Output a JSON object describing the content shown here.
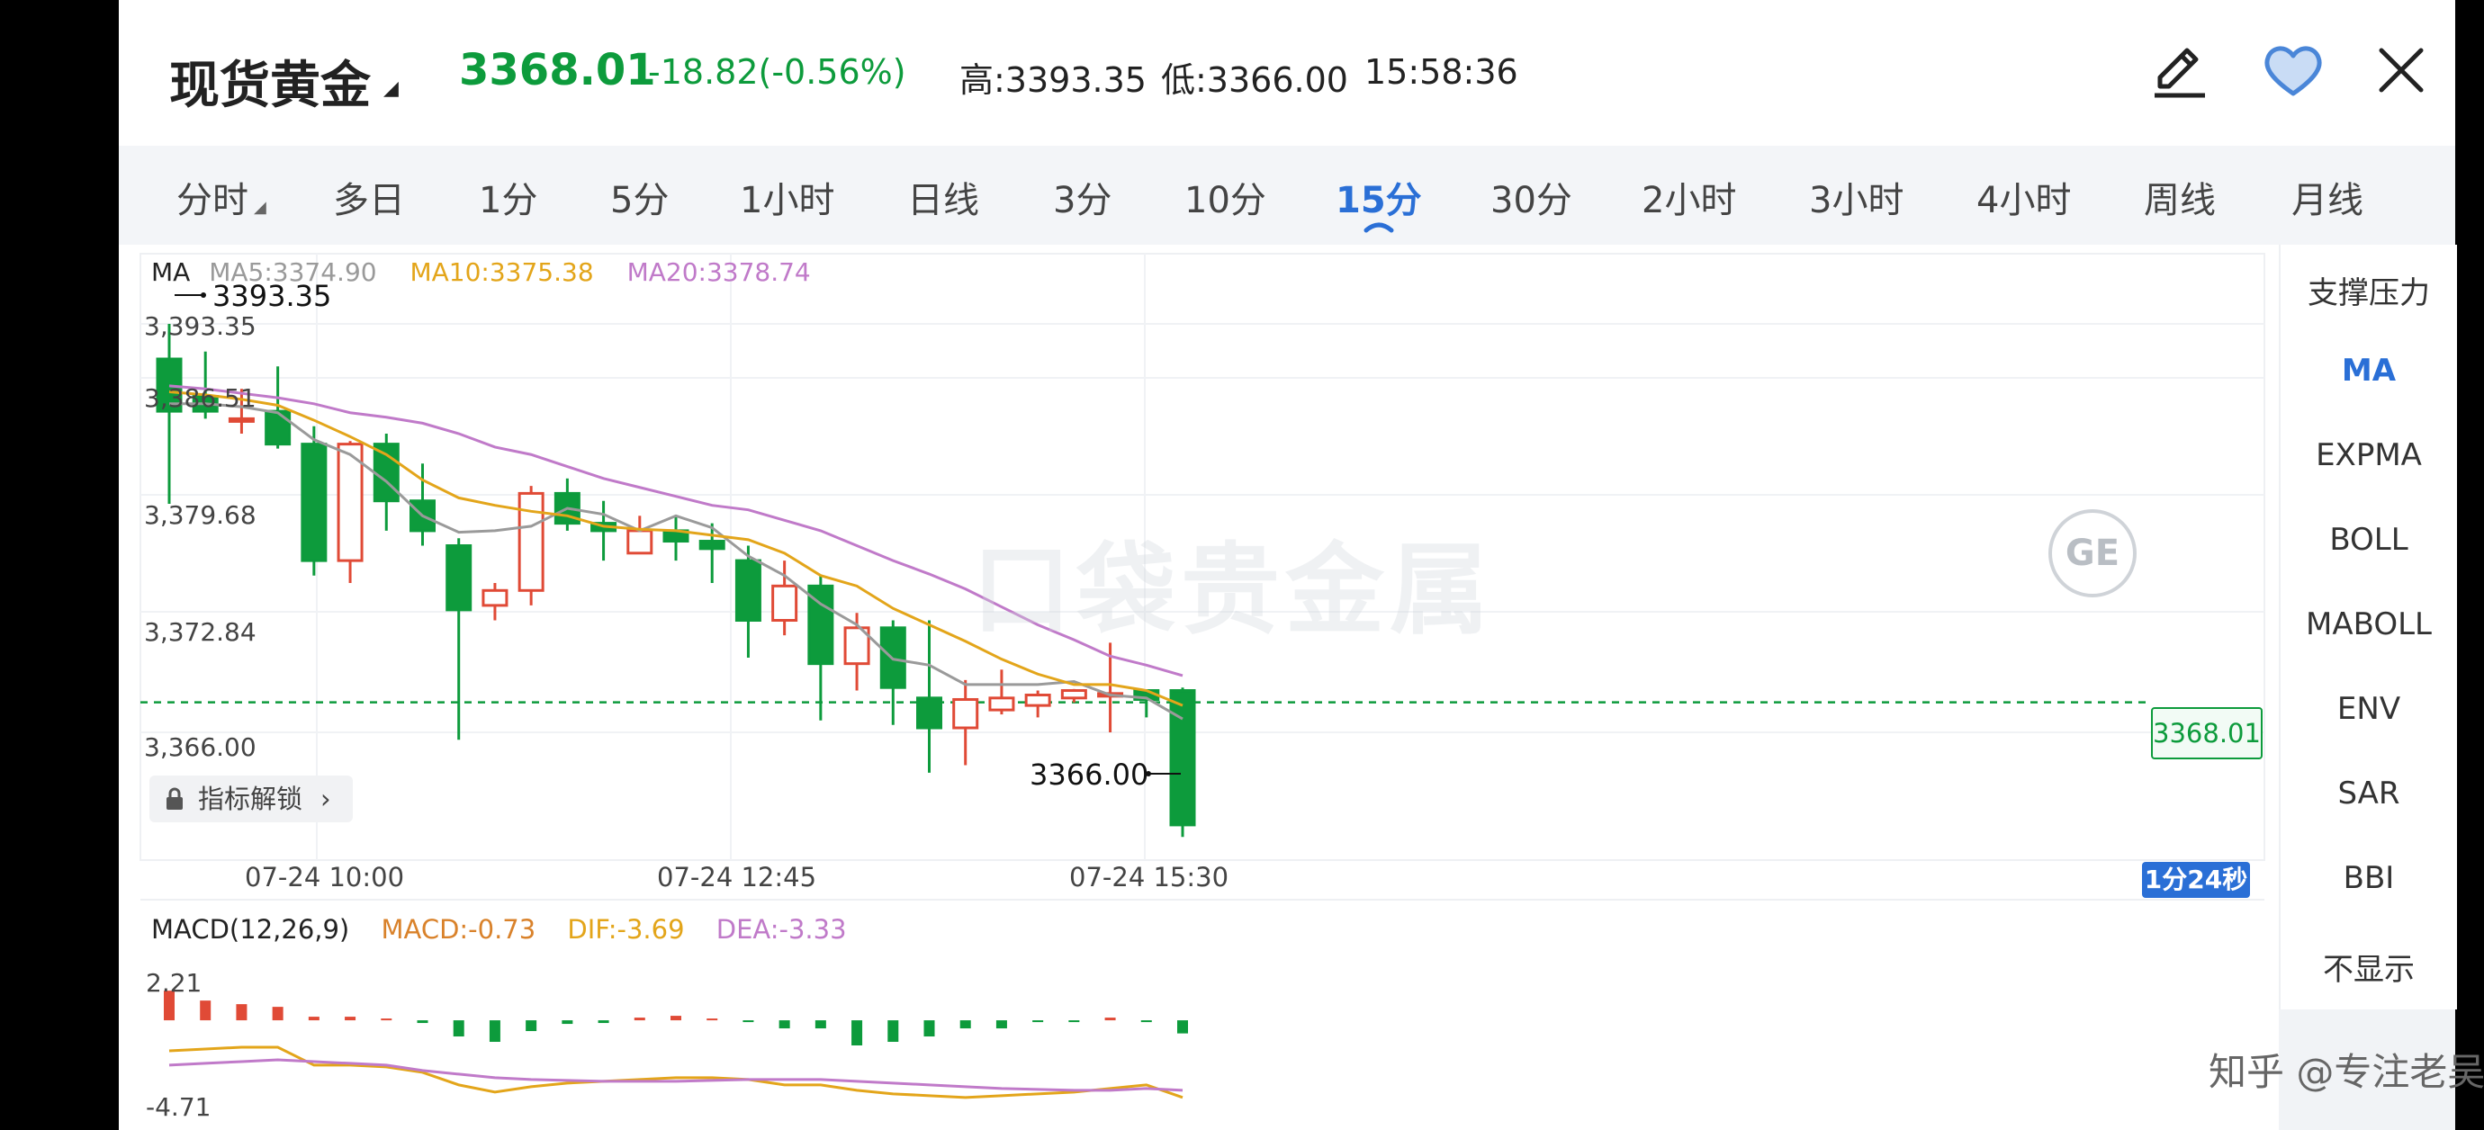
{
  "header": {
    "title": "现货黄金",
    "price": "3368.01",
    "change": "-18.82(-0.56%)",
    "high": "高:3393.35",
    "low": "低:3366.00",
    "time": "15:58:36"
  },
  "tabs": [
    {
      "label": "分时"
    },
    {
      "label": "多日"
    },
    {
      "label": "1分"
    },
    {
      "label": "5分"
    },
    {
      "label": "1小时"
    },
    {
      "label": "日线"
    },
    {
      "label": "3分"
    },
    {
      "label": "10分"
    },
    {
      "label": "15分",
      "active": true
    },
    {
      "label": "30分"
    },
    {
      "label": "2小时"
    },
    {
      "label": "3小时"
    },
    {
      "label": "4小时"
    },
    {
      "label": "周线"
    },
    {
      "label": "月线"
    }
  ],
  "indicators": [
    "支撑压力",
    "MA",
    "EXPMA",
    "BOLL",
    "MABOLL",
    "ENV",
    "SAR",
    "BBI",
    "不显示"
  ],
  "active_indicator": "MA",
  "ma_legend": {
    "label": "MA",
    "ma5": "MA5:3374.90",
    "ma10": "MA10:3375.38",
    "ma20": "MA20:3378.74"
  },
  "main_chart": {
    "y_ticks": [
      "3,393.35",
      "3,386.51",
      "3,379.68",
      "3,372.84",
      "3,366.00"
    ],
    "x_ticks": [
      "07-24 10:00",
      "07-24 12:45",
      "07-24 15:30"
    ],
    "high_label": "3393.35",
    "low_label": "3366.00",
    "last_price": "3368.01",
    "countdown": "1分24秒",
    "unlock_label": "指标解锁",
    "badge": "GE",
    "watermark": "口袋贵金属"
  },
  "macd": {
    "label": "MACD(12,26,9)",
    "macd": "MACD:-0.73",
    "dif": "DIF:-3.69",
    "dea": "DEA:-3.33",
    "y_top": "2.21",
    "y_bottom": "-4.71"
  },
  "footer_watermark": "知乎 @专注老吴",
  "colors": {
    "up": "#e04a36",
    "down": "#0d9b3c",
    "ma5": "#9a9a9a",
    "ma10": "#e3a51a",
    "ma20": "#c07ac9",
    "accent": "#2a6fd6"
  },
  "chart_data": {
    "type": "candlestick",
    "ylim": [
      3366.0,
      3393.35
    ],
    "candles": [
      {
        "o": 3391.0,
        "h": 3393.35,
        "l": 3381.3,
        "c": 3387.5
      },
      {
        "o": 3388.5,
        "h": 3391.5,
        "l": 3387.0,
        "c": 3387.5
      },
      {
        "o": 3387.0,
        "h": 3389.0,
        "l": 3386.0,
        "c": 3387.0
      },
      {
        "o": 3387.5,
        "h": 3390.5,
        "l": 3385.0,
        "c": 3385.3
      },
      {
        "o": 3385.3,
        "h": 3386.5,
        "l": 3376.5,
        "c": 3377.5
      },
      {
        "o": 3377.5,
        "h": 3385.5,
        "l": 3376.0,
        "c": 3385.3
      },
      {
        "o": 3385.3,
        "h": 3386.0,
        "l": 3379.5,
        "c": 3381.5
      },
      {
        "o": 3381.5,
        "h": 3384.0,
        "l": 3378.5,
        "c": 3379.5
      },
      {
        "o": 3378.5,
        "h": 3379.0,
        "l": 3365.5,
        "c": 3374.2
      },
      {
        "o": 3374.5,
        "h": 3376.0,
        "l": 3373.5,
        "c": 3375.5
      },
      {
        "o": 3375.5,
        "h": 3382.5,
        "l": 3374.5,
        "c": 3382.0
      },
      {
        "o": 3382.0,
        "h": 3383.0,
        "l": 3379.5,
        "c": 3380.0
      },
      {
        "o": 3380.0,
        "h": 3381.5,
        "l": 3377.5,
        "c": 3379.5
      },
      {
        "o": 3378.0,
        "h": 3380.5,
        "l": 3378.0,
        "c": 3379.5
      },
      {
        "o": 3379.5,
        "h": 3380.5,
        "l": 3377.5,
        "c": 3378.8
      },
      {
        "o": 3378.8,
        "h": 3380.0,
        "l": 3376.0,
        "c": 3378.3
      },
      {
        "o": 3377.5,
        "h": 3378.5,
        "l": 3371.0,
        "c": 3373.5
      },
      {
        "o": 3373.5,
        "h": 3377.5,
        "l": 3372.5,
        "c": 3375.8
      },
      {
        "o": 3375.8,
        "h": 3376.5,
        "l": 3366.8,
        "c": 3370.6
      },
      {
        "o": 3370.6,
        "h": 3374.0,
        "l": 3368.8,
        "c": 3373.0
      },
      {
        "o": 3373.0,
        "h": 3373.5,
        "l": 3366.5,
        "c": 3369.0
      },
      {
        "o": 3368.3,
        "h": 3373.5,
        "l": 3363.3,
        "c": 3366.3
      },
      {
        "o": 3366.3,
        "h": 3369.5,
        "l": 3363.8,
        "c": 3368.2
      },
      {
        "o": 3367.5,
        "h": 3370.2,
        "l": 3367.2,
        "c": 3368.3
      },
      {
        "o": 3367.8,
        "h": 3368.8,
        "l": 3367.0,
        "c": 3368.5
      },
      {
        "o": 3368.3,
        "h": 3368.9,
        "l": 3368.0,
        "c": 3368.8
      },
      {
        "o": 3368.6,
        "h": 3372.0,
        "l": 3366.0,
        "c": 3368.6
      },
      {
        "o": 3368.8,
        "h": 3368.8,
        "l": 3367.0,
        "c": 3368.2
      },
      {
        "o": 3368.8,
        "h": 3369.0,
        "l": 3359.0,
        "c": 3359.8
      }
    ],
    "ma5": [
      3388.0,
      3388.0,
      3387.8,
      3387.4,
      3385.6,
      3384.6,
      3382.8,
      3380.5,
      3379.4,
      3379.5,
      3379.8,
      3381.0,
      3380.6,
      3379.5,
      3380.5,
      3379.7,
      3377.8,
      3376.5,
      3374.6,
      3373.2,
      3370.9,
      3370.5,
      3369.2,
      3369.2,
      3369.2,
      3369.4,
      3368.5,
      3368.3,
      3366.9
    ],
    "ma10": [
      3388.8,
      3388.6,
      3388.3,
      3387.9,
      3386.9,
      3385.8,
      3384.6,
      3382.9,
      3381.7,
      3381.2,
      3380.8,
      3380.5,
      3379.8,
      3379.6,
      3379.5,
      3379.2,
      3378.9,
      3378.0,
      3376.5,
      3375.8,
      3374.3,
      3373.2,
      3372.1,
      3370.9,
      3369.9,
      3369.2,
      3369.2,
      3368.8,
      3367.8
    ],
    "ma20": [
      3389.2,
      3389.0,
      3388.7,
      3388.4,
      3388.0,
      3387.4,
      3387.1,
      3386.7,
      3386.0,
      3385.1,
      3384.6,
      3383.8,
      3383.0,
      3382.4,
      3381.8,
      3381.2,
      3380.9,
      3380.2,
      3379.5,
      3378.5,
      3377.5,
      3376.6,
      3375.6,
      3374.4,
      3373.2,
      3372.2,
      3371.1,
      3370.5,
      3369.8
    ],
    "macd_ylim": [
      -4.71,
      2.21
    ],
    "macd_hist": [
      1.65,
      1.1,
      0.9,
      0.75,
      0.2,
      0.2,
      0.1,
      -0.15,
      -0.9,
      -1.2,
      -0.6,
      -0.2,
      -0.15,
      0.15,
      0.25,
      0.1,
      -0.05,
      -0.45,
      -0.45,
      -1.4,
      -1.2,
      -0.9,
      -0.45,
      -0.45,
      -0.05,
      -0.05,
      0.15,
      -0.05,
      -0.73
    ],
    "dif": [
      -1.7,
      -1.6,
      -1.5,
      -1.5,
      -2.5,
      -2.5,
      -2.6,
      -2.9,
      -3.6,
      -4.0,
      -3.7,
      -3.5,
      -3.4,
      -3.3,
      -3.2,
      -3.2,
      -3.3,
      -3.6,
      -3.6,
      -3.9,
      -4.1,
      -4.2,
      -4.3,
      -4.2,
      -4.1,
      -4.0,
      -3.8,
      -3.6,
      -4.3
    ],
    "dea": [
      -2.5,
      -2.4,
      -2.3,
      -2.2,
      -2.3,
      -2.4,
      -2.5,
      -2.8,
      -3.0,
      -3.2,
      -3.3,
      -3.35,
      -3.4,
      -3.4,
      -3.4,
      -3.35,
      -3.3,
      -3.3,
      -3.3,
      -3.4,
      -3.5,
      -3.6,
      -3.7,
      -3.8,
      -3.85,
      -3.9,
      -3.9,
      -3.8,
      -3.9
    ]
  }
}
